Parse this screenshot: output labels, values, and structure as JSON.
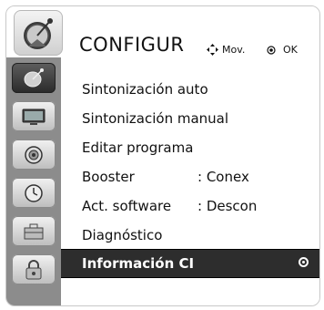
{
  "header": {
    "title": "CONFIGUR",
    "icon": "satellite-icon",
    "hint_nav": "Mov.",
    "hint_ok": "OK"
  },
  "sidebar": {
    "items": [
      {
        "icon": "satellite-icon",
        "active": true
      },
      {
        "icon": "tv-screen-icon",
        "active": false
      },
      {
        "icon": "speaker-icon",
        "active": false
      },
      {
        "icon": "clock-icon",
        "active": false
      },
      {
        "icon": "toolbox-icon",
        "active": false
      },
      {
        "icon": "lock-icon",
        "active": false
      }
    ]
  },
  "menu": {
    "items": [
      {
        "label": "Sintonización auto",
        "value": ""
      },
      {
        "label": "Sintonización manual",
        "value": ""
      },
      {
        "label": "Editar programa",
        "value": ""
      },
      {
        "label": "Booster",
        "value": ": Conex"
      },
      {
        "label": "Act. software",
        "value": ": Descon"
      },
      {
        "label": "Diagnóstico",
        "value": ""
      },
      {
        "label": "Información CI",
        "value": "",
        "selected": true
      }
    ]
  },
  "colors": {
    "sidebar_bg": "#8c8c8c",
    "selected_row_bg": "#2d2d2d",
    "text": "#111111"
  }
}
